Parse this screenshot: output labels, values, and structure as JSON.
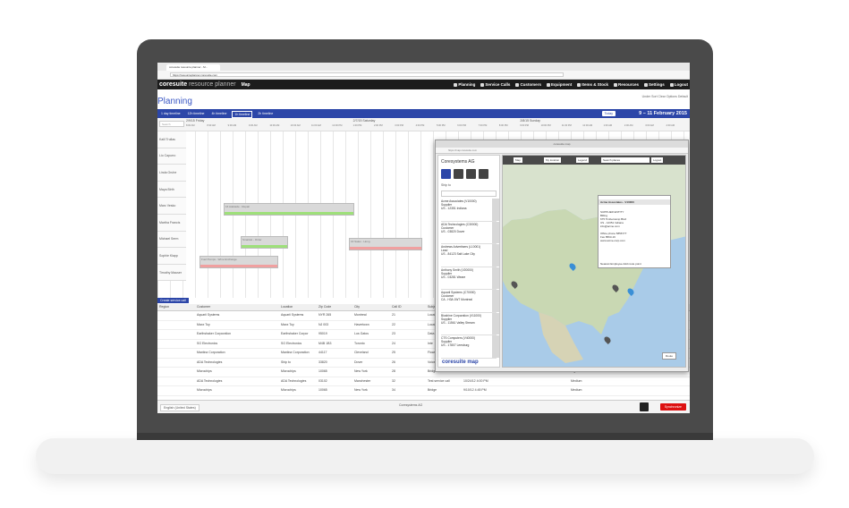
{
  "browser": {
    "tab_title": "coresuite resource planner - M...",
    "address": "https://resourceplanner.coresuite.com"
  },
  "app": {
    "brand_main": "coresuite",
    "brand_product": "resource planner",
    "brand_map": "Map"
  },
  "topnav": [
    "Planning",
    "Service Calls",
    "Customers",
    "Equipment",
    "Items & Stock",
    "Resources",
    "Settings",
    "Logout"
  ],
  "page": {
    "title": "Planning",
    "right_labels": "Under Sort   Clear   Options   Default"
  },
  "timeline": {
    "tabs": [
      "1 day timeline",
      "12h timeline",
      "4h timeline",
      "1h timeline",
      "2h timeline"
    ],
    "active_tab": 3,
    "today_label": "Today",
    "date_range": "9 – 11 February 2015",
    "search_placeholder": "Search",
    "days": [
      "2/9/15 Friday",
      "2/7/15 Saturday",
      "2/8/15 Sunday"
    ],
    "hours": [
      "8:00 AM",
      "8:30 AM",
      "9:00 AM",
      "9:30 AM",
      "10:00 AM",
      "10:30 AM",
      "11:00 AM",
      "12:00 PM",
      "1:00 PM",
      "2:00 PM",
      "3:00 PM",
      "4:00 PM",
      "5:00 PM",
      "6:00 PM",
      "7:00 PM",
      "8:00 PM",
      "9:00 PM",
      "10:00 PM",
      "11:00 PM",
      "12:00 AM",
      "1:00 AM",
      "2:00 AM",
      "3:00 AM",
      "4:00 AM"
    ]
  },
  "resources": [
    "Kalil Trullas",
    "Lio Capurro",
    "Linda Gruhe",
    "Maya Birth",
    "Marc Vesko",
    "Martha Francis",
    "Michael Serm",
    "Sophie Klapp",
    "Timothy Mauser"
  ],
  "assignments": [
    {
      "label": "16 Adelaide - Repair"
    },
    {
      "label": "Smartek - Order"
    },
    {
      "label": "16 Sales - Hong"
    },
    {
      "label": "Fuel Pumps - Wine Exchange"
    }
  ],
  "create_link": "Create service call",
  "table": {
    "headers": [
      "Region",
      "Customer",
      "Location",
      "Zip Code",
      "City",
      "Call ID",
      "Subject",
      "Due Date",
      "Time",
      "Status",
      "Priority"
    ],
    "rows": [
      [
        "",
        "Aquarii Systems",
        "Aquarii Systems",
        "NYR 265",
        "Montreal",
        "21",
        "Local",
        "",
        "",
        "",
        ""
      ],
      [
        "",
        "Maxx Toy",
        "Maxx Toy",
        "NJ 003",
        "Havertown",
        "22",
        "Local",
        "",
        "",
        "",
        ""
      ],
      [
        "",
        "Earthshaker Corporation",
        "Earthshaker Corpor",
        "95019",
        "Los Gatos",
        "23",
        "Data",
        "",
        "",
        "",
        ""
      ],
      [
        "",
        "SG Electronics",
        "SG Electronics",
        "M4B 1B3",
        "Toronto",
        "24",
        "Inte",
        "",
        "",
        "",
        ""
      ],
      [
        "",
        "Maxtina Corporation",
        "Maxtina Corporation",
        "44117",
        "Cleveland",
        "25",
        "Flowe",
        "",
        "",
        "",
        ""
      ],
      [
        "",
        "ADA Technologies",
        "Ship to",
        "33820",
        "Dover",
        "26",
        "Voice",
        "",
        "",
        "",
        ""
      ],
      [
        "",
        "Microchips",
        "Microchips",
        "10065",
        "New York",
        "28",
        "Bridge",
        "9/10/12 3:40 PM",
        "",
        "",
        "High"
      ],
      [
        "",
        "ADA Technologies",
        "ADA Technologies",
        "03102",
        "Manchester",
        "32",
        "Test service call",
        "10/24/12 4:00 PM",
        "",
        "",
        "Medium"
      ],
      [
        "",
        "Microchips",
        "Microchips",
        "10065",
        "New York",
        "34",
        "Bridge",
        "9/10/12 4:45 PM",
        "",
        "",
        "Medium"
      ]
    ]
  },
  "footer": {
    "language": "English (United States)",
    "company": "Coresystems AG",
    "sync_button": "Synchronize"
  },
  "map_popup": {
    "window_title": "coresuite map",
    "address": "https://map.coresuite.com",
    "company_title": "Coresystems AG",
    "ship_to": "Ship to",
    "customers": [
      "Acme Associates (V10000)\nSupplier\nUS - 12351 Indiana",
      "ADA Technologies (C30000)\nCustomer\nUS - 03820 Dover",
      "Andrews Advertisers (L10001)\nLead\nUS - 84123 Salt Lake City",
      "Anthony Smith (V20000)\nSupplier\nUS - 03281 Weare",
      "Aquarii Systems (C70000)\nCustomer\nCA - H3A 1W7 Montreal",
      "Bioshine Corporation (V11000)\nSupplier\nUS - 11561 Valley Stream",
      "CTS Computers (V40000)\nSupplier\nUS - 17807 Leesburg"
    ],
    "map_controls": [
      "Map",
      "My location",
      "Legend",
      "Search places",
      "Logout"
    ],
    "info": {
      "title": "Acme Associates - V10000",
      "body": "SUPPLIER ENTITY\nBilling\n675 Timbercamp Blvd\nUS - 12351 Indiana\ninfo@acme.com\n\nOffice phone 5856777\nFax 8563-19\nwww.acme-corp.com",
      "footer": "Nearest Employee   Add route point"
    },
    "route_button": "Route",
    "logo": "coresuite map",
    "colors": {
      "pin_blue": "#3a8fd6",
      "pin_grey": "#555555"
    }
  }
}
